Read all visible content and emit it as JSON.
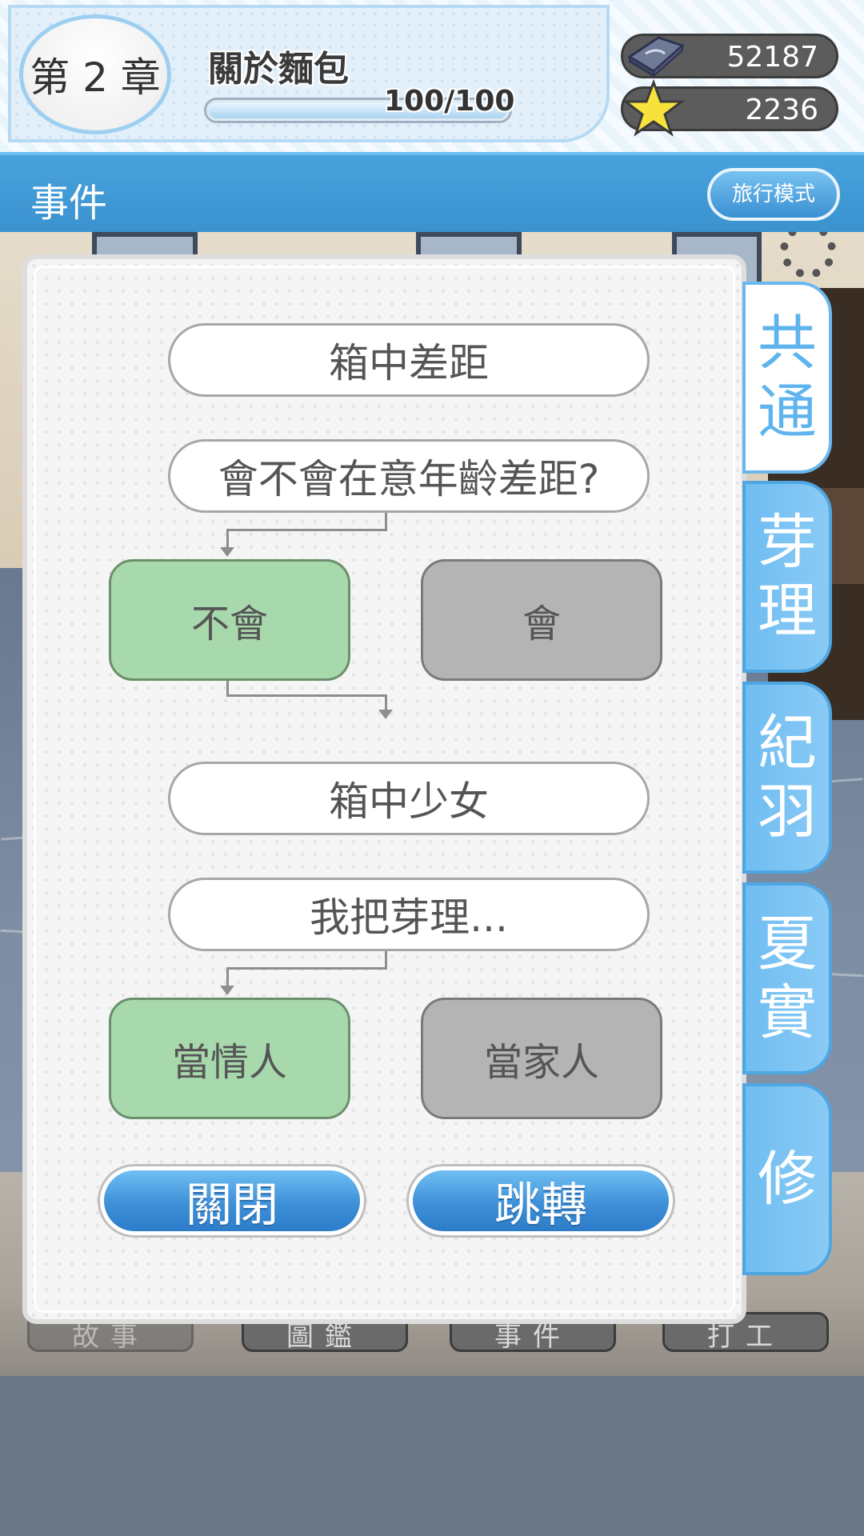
{
  "hud": {
    "chapter_label": "第 2 章",
    "chapter_title": "關於麵包",
    "progress_text": "100/100",
    "progress_fraction": 1.0,
    "currency_gem": "52187",
    "currency_star": "2236"
  },
  "titlebar": {
    "title": "事件",
    "travel_mode_label": "旅行模式"
  },
  "event_flow": {
    "section1_title": "箱中差距",
    "section1_question": "會不會在意年齡差距?",
    "section1_choice_selected": "不會",
    "section1_choice_other": "會",
    "section2_title": "箱中少女",
    "section2_question": "我把芽理...",
    "section2_choice_selected": "當情人",
    "section2_choice_other": "當家人"
  },
  "buttons": {
    "close_label": "關閉",
    "jump_label": "跳轉"
  },
  "side_tabs": [
    {
      "label_top": "共",
      "label_bottom": "通",
      "active": true
    },
    {
      "label_top": "芽",
      "label_bottom": "理",
      "active": false
    },
    {
      "label_top": "紀",
      "label_bottom": "羽",
      "active": false
    },
    {
      "label_top": "夏",
      "label_bottom": "實",
      "active": false
    },
    {
      "label_top": "修",
      "label_bottom": "",
      "active": false
    }
  ],
  "bottom_nav": [
    "故事",
    "圖鑑",
    "事件",
    "打工"
  ],
  "colors": {
    "accent_blue": "#3a92cf",
    "choice_selected": "#a8d9ac",
    "choice_unselected": "#b4b4b4",
    "tab_active_text": "#5fb4ee"
  },
  "icons": {
    "gem": "gem-icon",
    "star": "star-icon"
  }
}
